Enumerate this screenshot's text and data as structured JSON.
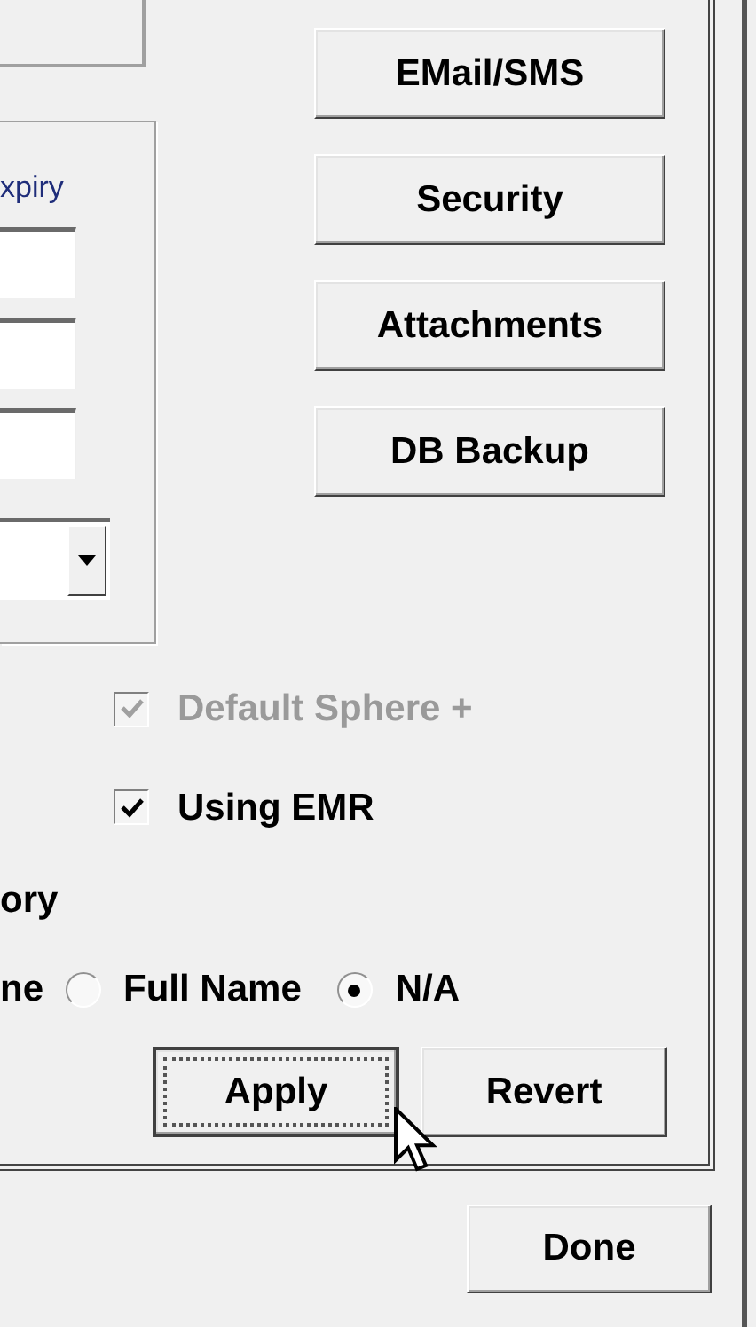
{
  "side_buttons": [
    {
      "label": "EMail/SMS"
    },
    {
      "label": "Security"
    },
    {
      "label": "Attachments"
    },
    {
      "label": "DB Backup"
    }
  ],
  "expiry_group": {
    "label": "xpiry",
    "fields": [
      {
        "kind": "text"
      },
      {
        "kind": "text"
      },
      {
        "kind": "text"
      },
      {
        "kind": "dropdown"
      }
    ]
  },
  "checkboxes": [
    {
      "label": "Default Sphere +",
      "checked": true,
      "disabled": true
    },
    {
      "label": "Using EMR",
      "checked": true,
      "disabled": false
    }
  ],
  "section_label": "ory",
  "radio_group": {
    "lead_text": "ne",
    "options": [
      {
        "label": "Full Name",
        "selected": false
      },
      {
        "label": "N/A",
        "selected": true
      }
    ]
  },
  "panel_buttons": [
    {
      "label": "Apply",
      "focused": true
    },
    {
      "label": "Revert",
      "focused": false
    }
  ],
  "done_button": "Done"
}
